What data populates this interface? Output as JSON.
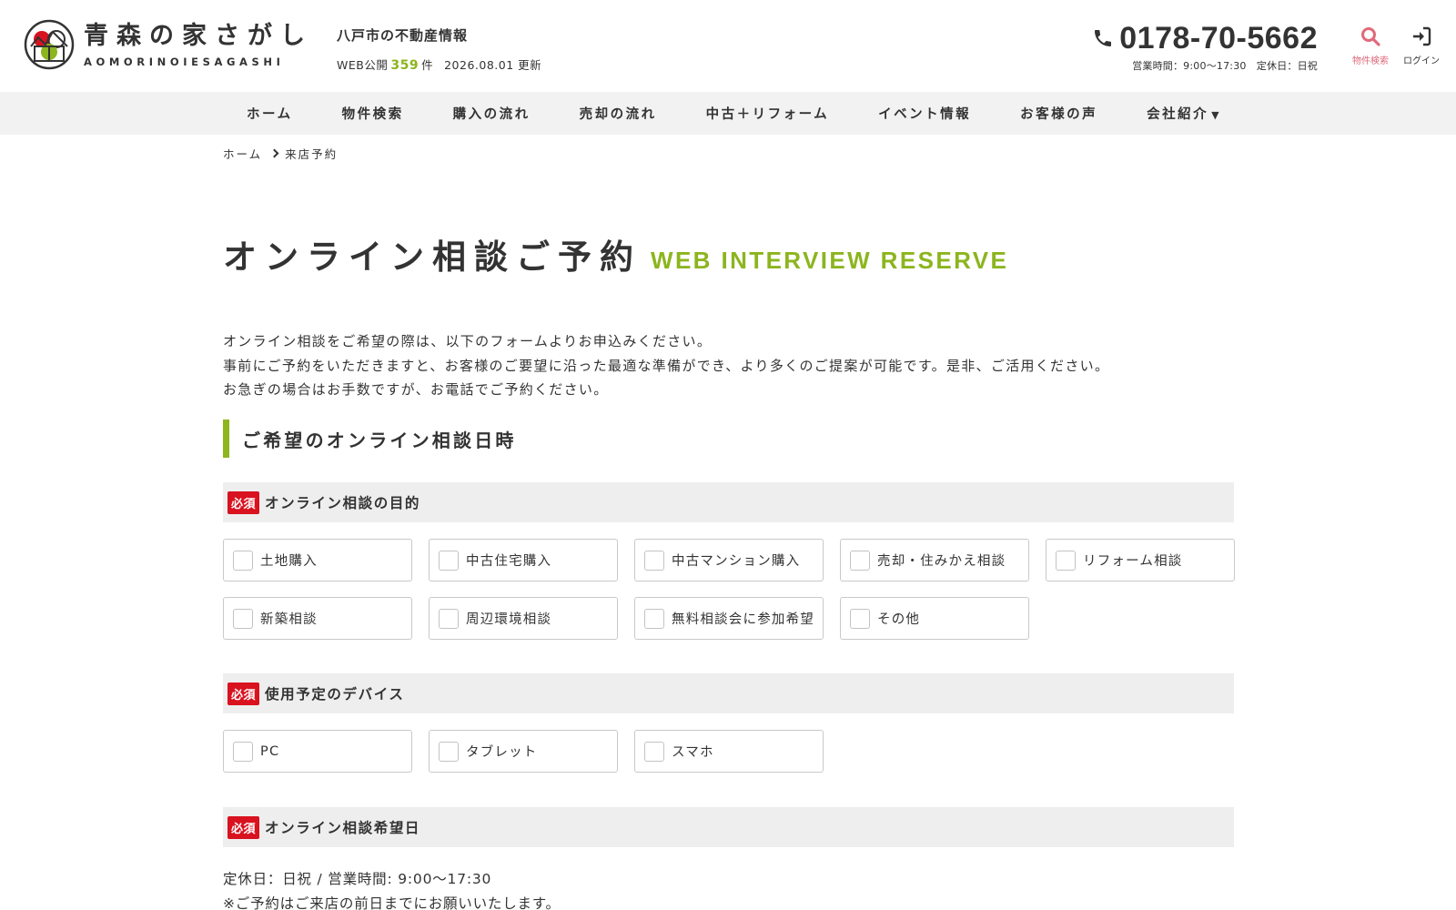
{
  "header": {
    "logo_ja": "青森の家さがし",
    "logo_en": "AOMORINOIESAGASHI",
    "tagline": "八戸市の不動産情報",
    "web_prefix": "WEB公開",
    "listing_count": "359",
    "count_unit": "件",
    "update_date": "2026.08.01 更新",
    "phone": "0178-70-5662",
    "hours": "営業時間：9:00〜17:30　定休日：日祝",
    "search_label": "物件検索",
    "login_label": "ログイン"
  },
  "nav": {
    "items": [
      "ホーム",
      "物件検索",
      "購入の流れ",
      "売却の流れ",
      "中古＋リフォーム",
      "イベント情報",
      "お客様の声",
      "会社紹介"
    ],
    "caret": "▼"
  },
  "breadcrumb": {
    "home": "ホーム",
    "current": "来店予約"
  },
  "page": {
    "title_ja": "オンライン相談ご予約",
    "title_en": "WEB INTERVIEW RESERVE",
    "intro": [
      "オンライン相談をご希望の際は、以下のフォームよりお申込みください。",
      "事前にご予約をいただきますと、お客様のご要望に沿った最適な準備ができ、より多くのご提案が可能です。是非、ご活用ください。",
      "お急ぎの場合はお手数ですが、お電話でご予約ください。"
    ],
    "section_heading": "ご希望のオンライン相談日時"
  },
  "form": {
    "required_badge": "必須",
    "purpose": {
      "label": "オンライン相談の目的",
      "options": [
        "土地購入",
        "中古住宅購入",
        "中古マンション購入",
        "売却・住みかえ相談",
        "リフォーム相談",
        "新築相談",
        "周辺環境相談",
        "無料相談会に参加希望",
        "その他"
      ]
    },
    "device": {
      "label": "使用予定のデバイス",
      "options": [
        "PC",
        "タブレット",
        "スマホ"
      ]
    },
    "date": {
      "label": "オンライン相談希望日",
      "notes": [
        "定休日：日祝 / 営業時間: 9:00〜17:30",
        "※ご予約はご来店の前日までにお願いいたします。"
      ]
    }
  },
  "colors": {
    "accent_green": "#8cb51e",
    "required_red": "#d9121f",
    "search_pink": "#e06a7a",
    "nav_bg": "#f2f2f2",
    "field_bg": "#eeeeee"
  },
  "icons": {
    "phone": "phone-icon",
    "search": "search-icon",
    "login": "login-icon",
    "breadcrumb_sep": "chevron-right-icon"
  }
}
